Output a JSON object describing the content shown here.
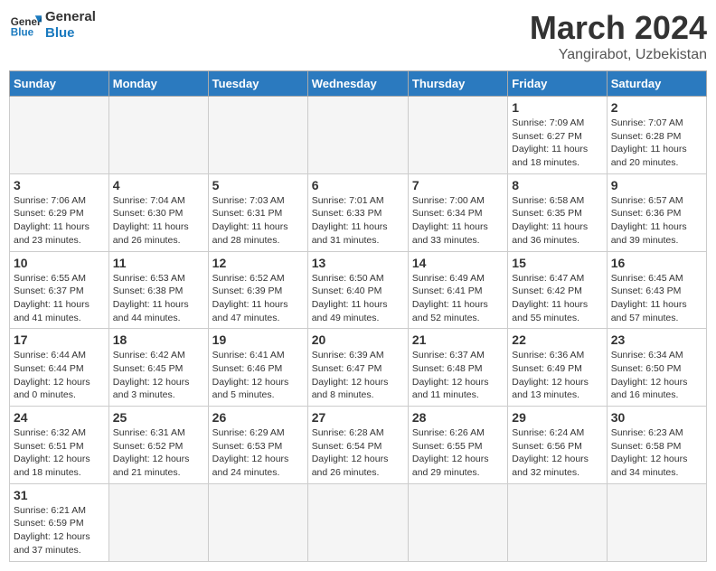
{
  "header": {
    "logo_general": "General",
    "logo_blue": "Blue",
    "month": "March 2024",
    "location": "Yangirabot, Uzbekistan"
  },
  "weekdays": [
    "Sunday",
    "Monday",
    "Tuesday",
    "Wednesday",
    "Thursday",
    "Friday",
    "Saturday"
  ],
  "weeks": [
    [
      {
        "day": "",
        "info": ""
      },
      {
        "day": "",
        "info": ""
      },
      {
        "day": "",
        "info": ""
      },
      {
        "day": "",
        "info": ""
      },
      {
        "day": "",
        "info": ""
      },
      {
        "day": "1",
        "info": "Sunrise: 7:09 AM\nSunset: 6:27 PM\nDaylight: 11 hours\nand 18 minutes."
      },
      {
        "day": "2",
        "info": "Sunrise: 7:07 AM\nSunset: 6:28 PM\nDaylight: 11 hours\nand 20 minutes."
      }
    ],
    [
      {
        "day": "3",
        "info": "Sunrise: 7:06 AM\nSunset: 6:29 PM\nDaylight: 11 hours\nand 23 minutes."
      },
      {
        "day": "4",
        "info": "Sunrise: 7:04 AM\nSunset: 6:30 PM\nDaylight: 11 hours\nand 26 minutes."
      },
      {
        "day": "5",
        "info": "Sunrise: 7:03 AM\nSunset: 6:31 PM\nDaylight: 11 hours\nand 28 minutes."
      },
      {
        "day": "6",
        "info": "Sunrise: 7:01 AM\nSunset: 6:33 PM\nDaylight: 11 hours\nand 31 minutes."
      },
      {
        "day": "7",
        "info": "Sunrise: 7:00 AM\nSunset: 6:34 PM\nDaylight: 11 hours\nand 33 minutes."
      },
      {
        "day": "8",
        "info": "Sunrise: 6:58 AM\nSunset: 6:35 PM\nDaylight: 11 hours\nand 36 minutes."
      },
      {
        "day": "9",
        "info": "Sunrise: 6:57 AM\nSunset: 6:36 PM\nDaylight: 11 hours\nand 39 minutes."
      }
    ],
    [
      {
        "day": "10",
        "info": "Sunrise: 6:55 AM\nSunset: 6:37 PM\nDaylight: 11 hours\nand 41 minutes."
      },
      {
        "day": "11",
        "info": "Sunrise: 6:53 AM\nSunset: 6:38 PM\nDaylight: 11 hours\nand 44 minutes."
      },
      {
        "day": "12",
        "info": "Sunrise: 6:52 AM\nSunset: 6:39 PM\nDaylight: 11 hours\nand 47 minutes."
      },
      {
        "day": "13",
        "info": "Sunrise: 6:50 AM\nSunset: 6:40 PM\nDaylight: 11 hours\nand 49 minutes."
      },
      {
        "day": "14",
        "info": "Sunrise: 6:49 AM\nSunset: 6:41 PM\nDaylight: 11 hours\nand 52 minutes."
      },
      {
        "day": "15",
        "info": "Sunrise: 6:47 AM\nSunset: 6:42 PM\nDaylight: 11 hours\nand 55 minutes."
      },
      {
        "day": "16",
        "info": "Sunrise: 6:45 AM\nSunset: 6:43 PM\nDaylight: 11 hours\nand 57 minutes."
      }
    ],
    [
      {
        "day": "17",
        "info": "Sunrise: 6:44 AM\nSunset: 6:44 PM\nDaylight: 12 hours\nand 0 minutes."
      },
      {
        "day": "18",
        "info": "Sunrise: 6:42 AM\nSunset: 6:45 PM\nDaylight: 12 hours\nand 3 minutes."
      },
      {
        "day": "19",
        "info": "Sunrise: 6:41 AM\nSunset: 6:46 PM\nDaylight: 12 hours\nand 5 minutes."
      },
      {
        "day": "20",
        "info": "Sunrise: 6:39 AM\nSunset: 6:47 PM\nDaylight: 12 hours\nand 8 minutes."
      },
      {
        "day": "21",
        "info": "Sunrise: 6:37 AM\nSunset: 6:48 PM\nDaylight: 12 hours\nand 11 minutes."
      },
      {
        "day": "22",
        "info": "Sunrise: 6:36 AM\nSunset: 6:49 PM\nDaylight: 12 hours\nand 13 minutes."
      },
      {
        "day": "23",
        "info": "Sunrise: 6:34 AM\nSunset: 6:50 PM\nDaylight: 12 hours\nand 16 minutes."
      }
    ],
    [
      {
        "day": "24",
        "info": "Sunrise: 6:32 AM\nSunset: 6:51 PM\nDaylight: 12 hours\nand 18 minutes."
      },
      {
        "day": "25",
        "info": "Sunrise: 6:31 AM\nSunset: 6:52 PM\nDaylight: 12 hours\nand 21 minutes."
      },
      {
        "day": "26",
        "info": "Sunrise: 6:29 AM\nSunset: 6:53 PM\nDaylight: 12 hours\nand 24 minutes."
      },
      {
        "day": "27",
        "info": "Sunrise: 6:28 AM\nSunset: 6:54 PM\nDaylight: 12 hours\nand 26 minutes."
      },
      {
        "day": "28",
        "info": "Sunrise: 6:26 AM\nSunset: 6:55 PM\nDaylight: 12 hours\nand 29 minutes."
      },
      {
        "day": "29",
        "info": "Sunrise: 6:24 AM\nSunset: 6:56 PM\nDaylight: 12 hours\nand 32 minutes."
      },
      {
        "day": "30",
        "info": "Sunrise: 6:23 AM\nSunset: 6:58 PM\nDaylight: 12 hours\nand 34 minutes."
      }
    ],
    [
      {
        "day": "31",
        "info": "Sunrise: 6:21 AM\nSunset: 6:59 PM\nDaylight: 12 hours\nand 37 minutes."
      },
      {
        "day": "",
        "info": ""
      },
      {
        "day": "",
        "info": ""
      },
      {
        "day": "",
        "info": ""
      },
      {
        "day": "",
        "info": ""
      },
      {
        "day": "",
        "info": ""
      },
      {
        "day": "",
        "info": ""
      }
    ]
  ]
}
